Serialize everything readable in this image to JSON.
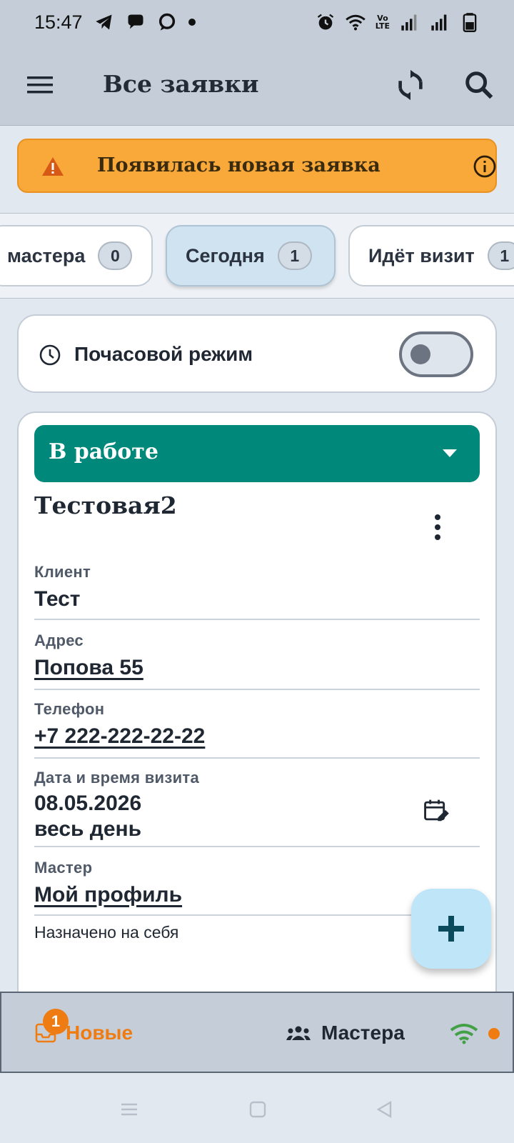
{
  "status_bar": {
    "time": "15:47",
    "left_icons": [
      "telegram-icon",
      "chat-bubble-icon",
      "messenger-icon",
      "dot-icon"
    ],
    "right_icons": [
      "alarm-icon",
      "wifi-icon",
      "volte-icon",
      "signal-icon",
      "signal-icon",
      "battery-icon"
    ],
    "volte_line1": "Vo",
    "volte_line2": "LTE"
  },
  "app_bar": {
    "title": "Все заявки",
    "icons": [
      "menu-icon",
      "sync-icon",
      "search-icon"
    ]
  },
  "alert": {
    "text": "Появилась новая заявка",
    "color": "#f9a83a",
    "icons": [
      "warning-icon",
      "info-icon"
    ]
  },
  "filter_tabs": [
    {
      "label": "мастера",
      "count": "0"
    },
    {
      "label": "Сегодня",
      "count": "1",
      "active": true
    },
    {
      "label": "Идёт визит",
      "count": "1"
    }
  ],
  "hourly_mode": {
    "label": "Почасовой режим",
    "enabled": false
  },
  "job": {
    "status": "В работе",
    "status_color": "#00897b",
    "title": "Тестовая2",
    "client_label": "Клиент",
    "client": "Тест",
    "address_label": "Адрес",
    "address": "Попова 55",
    "phone_label": "Телефон",
    "phone": "+7 222-222-22-22",
    "visit_label": "Дата и время визита",
    "visit_date": "08.05.2026",
    "visit_time": "весь день",
    "master_label": "Мастер",
    "master": "Мой профиль",
    "assigned_note": "Назначено на себя"
  },
  "bottom_nav": {
    "new_label": "Новые",
    "new_badge": "1",
    "masters_label": "Мастера",
    "accent_color": "#ef7c12"
  }
}
